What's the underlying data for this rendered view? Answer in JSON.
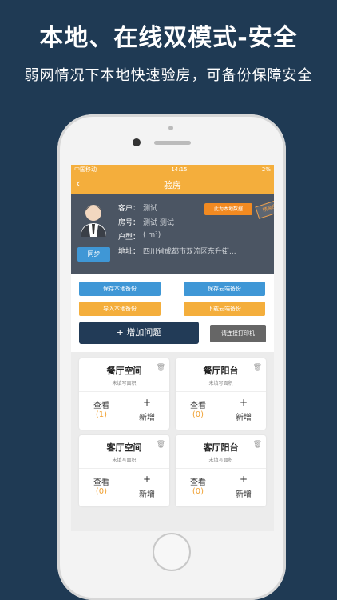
{
  "promo": {
    "title": "本地、在线双模式-安全",
    "subtitle": "弱网情况下本地快速验房，可备份保障安全"
  },
  "statusbar": {
    "carrier": "中国移动",
    "time": "14:15",
    "battery": "2%"
  },
  "navbar": {
    "title": "验房",
    "back_icon": "back-chevron-icon"
  },
  "profile": {
    "customer_label": "客户：",
    "customer_value": "测试",
    "room_label": "房号：",
    "room_value": "测试 测试",
    "layout_label": "户型：",
    "layout_value": "( m²)",
    "address_label": "地址：",
    "address_value": "四川省成都市双流区东升街...",
    "sync_label": "同步",
    "local_data_label": "此为本地数据",
    "stamp_label": "精装房"
  },
  "actions": {
    "save_local": "保存本地备份",
    "save_cloud": "保存云端备份",
    "import_local": "导入本地备份",
    "download_cloud": "下载云端备份",
    "add_issue": "+ 增加问题",
    "connect_printer": "请连接打印机"
  },
  "rooms": [
    {
      "name": "餐厅空间",
      "area": "未填写面积",
      "view": "查看",
      "count": "(1)",
      "plus": "+",
      "add": "新增"
    },
    {
      "name": "餐厅阳台",
      "area": "未填写面积",
      "view": "查看",
      "count": "(0)",
      "plus": "+",
      "add": "新增"
    },
    {
      "name": "客厅空间",
      "area": "未填写面积",
      "view": "查看",
      "count": "(0)",
      "plus": "+",
      "add": "新增"
    },
    {
      "name": "客厅阳台",
      "area": "未填写面积",
      "view": "查看",
      "count": "(0)",
      "plus": "+",
      "add": "新增"
    }
  ],
  "colors": {
    "background": "#1f3a54",
    "navbar": "#f4ae3c",
    "profile": "#4b5563",
    "blue_button": "#3f97d6",
    "orange_button": "#f4ae3c",
    "count": "#f0a132"
  }
}
